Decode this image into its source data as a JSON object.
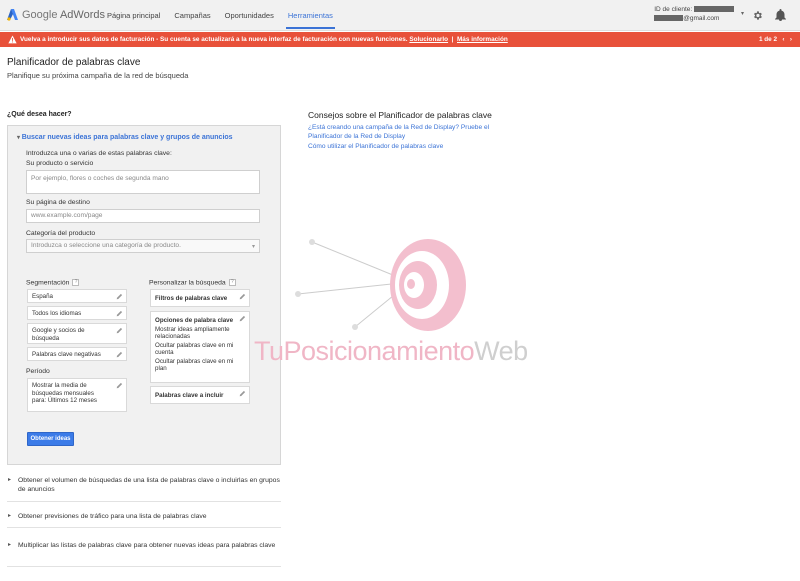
{
  "brand": {
    "google": "Google",
    "product": "AdWords"
  },
  "nav": {
    "items": [
      {
        "label": "Página principal",
        "active": false
      },
      {
        "label": "Campañas",
        "active": false
      },
      {
        "label": "Oportunidades",
        "active": false
      },
      {
        "label": "Herramientas",
        "active": true
      }
    ]
  },
  "account": {
    "client_label": "ID de cliente:",
    "email_suffix": "@gmail.com"
  },
  "alert": {
    "message": "Vuelva a introducir sus datos de facturación - Su cuenta se actualizará a la nueva interfaz de facturación con nuevas funciones.",
    "fix_link": "Solucionarlo",
    "separator": "|",
    "more_link": "Más información",
    "pager": "1 de 2",
    "prev": "‹",
    "next": "›",
    "color": "#e8513a"
  },
  "page": {
    "title": "Planificador de palabras clave",
    "subtitle": "Planifique su próxima campaña de la red de búsqueda",
    "question": "¿Qué desea hacer?"
  },
  "search_panel": {
    "heading": "Buscar nuevas ideas para palabras clave y grupos de anuncios",
    "intro": "Introduzca una o varias de estas palabras clave:",
    "product_label": "Su producto o servicio",
    "product_placeholder": "Por ejemplo, flores o coches de segunda mano",
    "landing_label": "Su página de destino",
    "landing_placeholder": "www.example.com/page",
    "category_label": "Categoría del producto",
    "category_placeholder": "Introduzca o seleccione una categoría de producto.",
    "targeting_label": "Segmentación",
    "targeting_items": [
      "España",
      "Todos los idiomas",
      "Google y socios de búsqueda",
      "Palabras clave negativas"
    ],
    "period_label": "Período",
    "period_value": "Mostrar la media de búsquedas mensuales para: Últimos 12 meses",
    "customize_label": "Personalizar la búsqueda",
    "keyword_filters": "Filtros de palabras clave",
    "keyword_options_title": "Opciones de palabra clave",
    "keyword_options": [
      "Mostrar ideas ampliamente relacionadas",
      "Ocultar palabras clave en mi cuenta",
      "Ocultar palabras clave en mi plan"
    ],
    "keywords_include": "Palabras clave a incluir",
    "help": "?",
    "submit": "Obtener ideas"
  },
  "other_options": [
    "Obtener el volumen de búsquedas de una lista de palabras clave o incluirlas en grupos de anuncios",
    "Obtener previsiones de tráfico para una lista de palabras clave",
    "Multiplicar las listas de palabras clave para obtener nuevas ideas para palabras clave"
  ],
  "tips": {
    "title": "Consejos sobre el Planificador de palabras clave",
    "links": [
      "¿Está creando una campaña de la Red de Display? Pruebe el Planificador de la Red de Display",
      "Cómo utilizar el Planificador de palabras clave"
    ]
  },
  "watermark": {
    "part1": "TuPosicionamiento",
    "part2": "Web"
  },
  "icons": {
    "logo": "adwords-logo-icon",
    "settings": "gear-icon",
    "notifications": "bell-icon",
    "alert": "warning-icon",
    "edit": "pencil-icon",
    "expand": "triangle-icon"
  },
  "colors": {
    "accent": "#3b73d6",
    "button": "#3b7be8",
    "alert": "#e8513a"
  }
}
